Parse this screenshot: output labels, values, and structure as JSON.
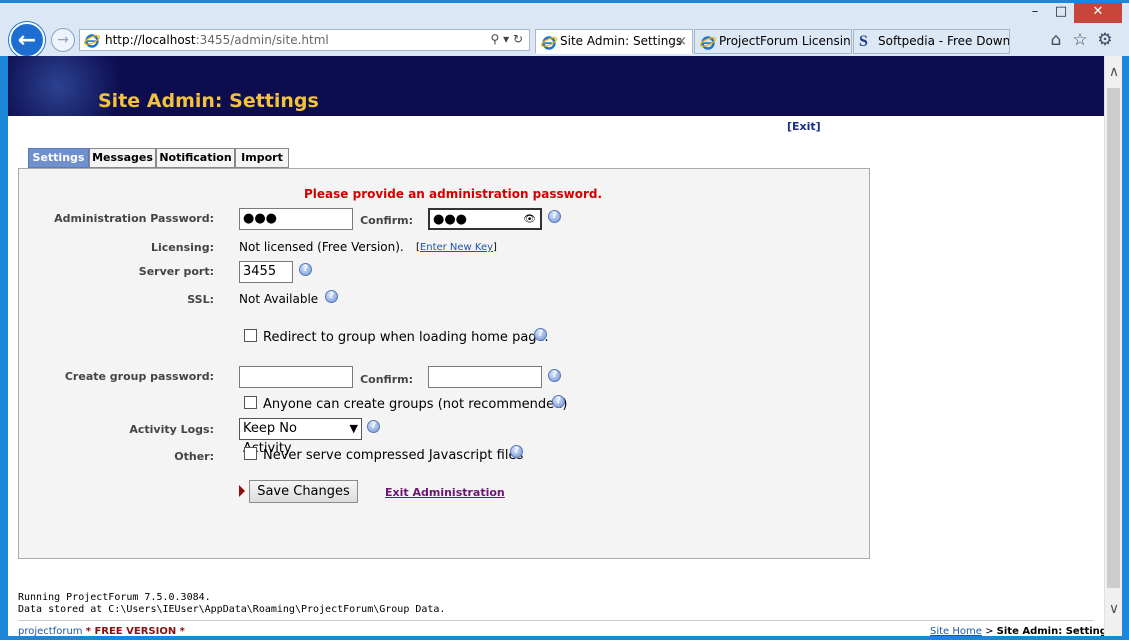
{
  "browser": {
    "url_host": "http://localhost",
    "url_rest": ":3455/admin/site.html",
    "tabs": [
      {
        "label": "Site Admin: Settings",
        "close": "×"
      },
      {
        "label": "ProjectForum Licensin..."
      },
      {
        "label": "Softpedia - Free Downl..."
      }
    ],
    "window_controls": {
      "minimize": "–",
      "maximize": "□",
      "close": "✕"
    },
    "icons": {
      "back": "back-arrow-icon",
      "forward": "forward-arrow-icon",
      "home": "home-icon",
      "favorites": "star-icon",
      "settings": "gear-icon"
    },
    "addr_tools": "⚲ ▾ ↻"
  },
  "page": {
    "title": "Site Admin: Settings",
    "exit_open": "[",
    "exit_label": "Exit",
    "exit_close": "]",
    "tabs": [
      "Settings",
      "Messages",
      "Notification",
      "Import"
    ],
    "error_message": "Please provide an administration password.",
    "admin_password": {
      "label": "Administration Password:",
      "value": "●●●",
      "confirm_label": "Confirm:",
      "confirm_value": "●●●"
    },
    "licensing": {
      "label": "Licensing:",
      "value": "Not licensed (Free Version).",
      "link_open": "[",
      "link_label": "Enter New Key",
      "link_close": "]"
    },
    "server_port": {
      "label": "Server port:",
      "value": "3455"
    },
    "ssl": {
      "label": "SSL:",
      "value": "Not Available"
    },
    "redirect": {
      "label": "Redirect to group when loading home page.",
      "checked": false
    },
    "create_group": {
      "label": "Create group password:",
      "value": "",
      "confirm_label": "Confirm:",
      "confirm_value": ""
    },
    "anyone_create": {
      "label": "Anyone can create groups (not recommended)",
      "checked": false
    },
    "activity_logs": {
      "label": "Activity Logs:",
      "selected": "Keep No Activity"
    },
    "other": {
      "label": "Other:",
      "option": "Never serve compressed Javascript files",
      "checked": false
    },
    "save_button": "Save Changes",
    "exit_admin": "Exit Administration",
    "footer_running": "Running ProjectForum 7.5.0.3084.",
    "footer_data": "Data stored at C:\\Users\\IEUser\\AppData\\Roaming\\ProjectForum\\Group Data.",
    "bottom_logo": "projectforum",
    "bottom_free": "* FREE VERSION *",
    "crumb_home": "Site Home",
    "crumb_sep": " > ",
    "crumb_current": "Site Admin: Settings"
  },
  "colors": {
    "banner": "#0c0c4e",
    "title": "#f2c23a",
    "error": "#d40000",
    "active_tab": "#6f8fcf"
  }
}
